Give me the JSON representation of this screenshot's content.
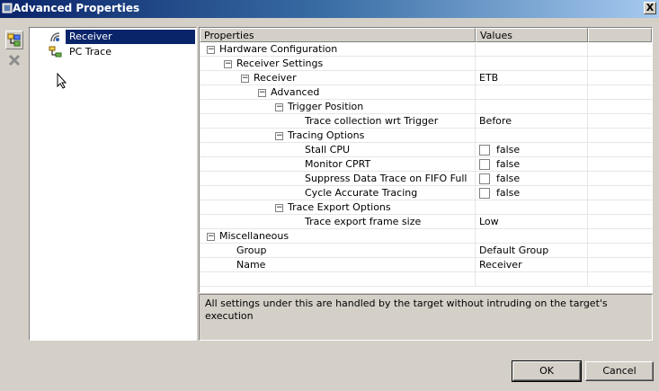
{
  "window": {
    "title": "Advanced Properties",
    "close_glyph": "X"
  },
  "toolbar": {
    "icons": [
      "add-trace-icon",
      "delete-icon"
    ]
  },
  "tree": {
    "items": [
      {
        "label": "Receiver",
        "icon": "receiver-icon",
        "selected": true
      },
      {
        "label": "PC Trace",
        "icon": "pc-trace-icon",
        "selected": false
      }
    ]
  },
  "grid": {
    "headers": {
      "properties": "Properties",
      "values": "Values"
    },
    "rows": [
      {
        "label": "Hardware Configuration",
        "value": ""
      },
      {
        "label": "Receiver Settings",
        "value": ""
      },
      {
        "label": "Receiver",
        "value": "ETB"
      },
      {
        "label": "Advanced",
        "value": ""
      },
      {
        "label": "Trigger Position",
        "value": ""
      },
      {
        "label": "Trace collection wrt Trigger",
        "value": "Before"
      },
      {
        "label": "Tracing Options",
        "value": ""
      },
      {
        "label": "Stall CPU",
        "value": "false"
      },
      {
        "label": "Monitor CPRT",
        "value": "false"
      },
      {
        "label": "Suppress Data Trace on FIFO Full",
        "value": "false"
      },
      {
        "label": "Cycle Accurate Tracing",
        "value": "false"
      },
      {
        "label": "Trace Export Options",
        "value": ""
      },
      {
        "label": "Trace export frame size",
        "value": "Low"
      },
      {
        "label": "Miscellaneous",
        "value": ""
      },
      {
        "label": "Group",
        "value": "Default Group"
      },
      {
        "label": "Name",
        "value": "Receiver"
      }
    ],
    "expander_glyph": "−"
  },
  "description": "All settings under this are handled by the target without intruding on the target's execution",
  "buttons": {
    "ok": "OK",
    "cancel": "Cancel"
  }
}
